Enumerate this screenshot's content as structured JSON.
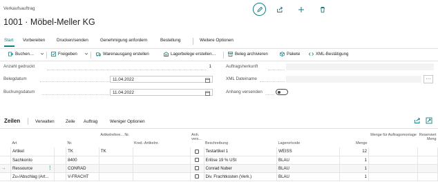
{
  "header": {
    "subtitle": "Verkaufsauftrag",
    "title": "1001 · Möbel-Meller KG",
    "icons": [
      "edit-icon",
      "share-icon",
      "add-icon",
      "delete-icon"
    ],
    "accent_color": "#107c80"
  },
  "tabs": [
    {
      "label": "Start",
      "active": true
    },
    {
      "label": "Vorbereiten"
    },
    {
      "label": "Drucken/senden"
    },
    {
      "label": "Genehmigung anfordern"
    },
    {
      "label": "Bestellung"
    },
    {
      "label": "Weitere Optionen"
    }
  ],
  "toolbar": {
    "items": [
      {
        "label": "Buchen…",
        "icon": "post-icon"
      },
      {
        "label": "Freigeben",
        "icon": "release-icon"
      },
      {
        "label": "Warenausgang erstellen",
        "icon": "shipment-icon"
      },
      {
        "label": "Lagerbelege erstellen…",
        "icon": "warehouse-icon"
      },
      {
        "label": "Beleg archivieren",
        "icon": "archive-icon"
      },
      {
        "label": "Pakete",
        "icon": "package-icon"
      },
      {
        "label": "XML-Bestätigung",
        "icon": "xml-icon"
      }
    ]
  },
  "fields_left": {
    "anzahl_gedruckt": {
      "label": "Anzahl gedruckt",
      "value": "1"
    },
    "belegdatum": {
      "label": "Belegdatum",
      "value": "11.04.2022"
    },
    "buchungsdatum": {
      "label": "Buchungsdatum",
      "value": "11.04.2022"
    }
  },
  "fields_right": {
    "auftragsherkunft": {
      "label": "Auftragsherkunft",
      "value": ""
    },
    "xml_dateiname": {
      "label": "XML Dateiname",
      "value": ""
    },
    "anhang_versenden": {
      "label": "Anhang versenden",
      "value": false
    }
  },
  "lines": {
    "title": "Zeilen",
    "actions": [
      "Verwalten",
      "Zeile",
      "Auftrag",
      "Weniger Optionen"
    ],
    "columns": [
      "Art",
      "Nr.",
      "Artikelrefere... Nr.",
      "Kred.-Artikelnr.",
      "Anh. vers...",
      "Beschreibung",
      "Lagerortcode",
      "Menge",
      "Menge für Auftragsmontage",
      "Reserviert Meng"
    ],
    "rows": [
      {
        "art": "Artikel",
        "nr": "TK",
        "ref": "TK",
        "kred": "",
        "anh": false,
        "beschreibung": "Testartikel 1",
        "lager": "WEISS",
        "menge": "12",
        "montage": "",
        "reserviert": ""
      },
      {
        "art": "Sachkonto",
        "nr": "8400",
        "ref": "",
        "kred": "",
        "anh": false,
        "beschreibung": "Erlöse 19 % USt",
        "lager": "BLAU",
        "menge": "1",
        "montage": "",
        "reserviert": ""
      },
      {
        "art": "Ressource",
        "nr": "CONRAD",
        "ref": "",
        "kred": "",
        "anh": false,
        "beschreibung": "Conrad Nuber",
        "lager": "BLAU",
        "menge": "1",
        "montage": "",
        "reserviert": "",
        "selected": true
      },
      {
        "art": "Zu-/Abschlag (Art...",
        "nr": "V-FRACHT",
        "ref": "",
        "kred": "",
        "anh": false,
        "beschreibung": "Div. Frachtkosten (Verk.)",
        "lager": "BLAU",
        "menge": "1",
        "montage": "",
        "reserviert": ""
      }
    ]
  }
}
